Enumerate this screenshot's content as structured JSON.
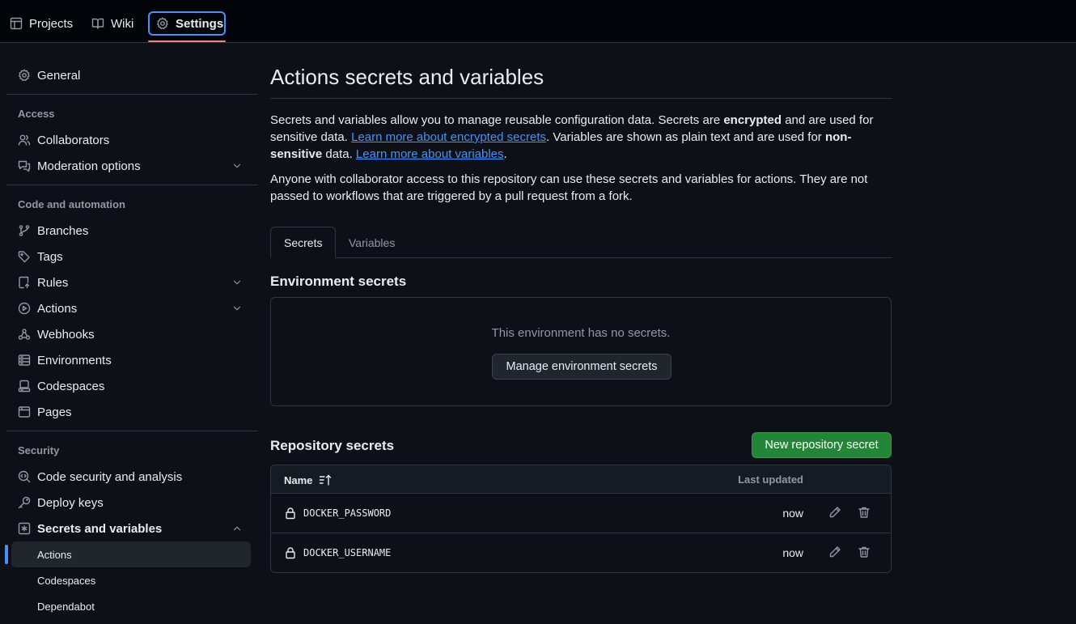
{
  "topnav": {
    "projects": "Projects",
    "wiki": "Wiki",
    "settings": "Settings"
  },
  "sidebar": {
    "general": "General",
    "access_heading": "Access",
    "collaborators": "Collaborators",
    "moderation": "Moderation options",
    "code_heading": "Code and automation",
    "branches": "Branches",
    "tags": "Tags",
    "rules": "Rules",
    "actions": "Actions",
    "webhooks": "Webhooks",
    "environments": "Environments",
    "codespaces": "Codespaces",
    "pages": "Pages",
    "security_heading": "Security",
    "code_security": "Code security and analysis",
    "deploy_keys": "Deploy keys",
    "secrets_vars": "Secrets and variables",
    "sub_actions": "Actions",
    "sub_codespaces": "Codespaces",
    "sub_dependabot": "Dependabot"
  },
  "main": {
    "title": "Actions secrets and variables",
    "intro": {
      "p1a": "Secrets and variables allow you to manage reusable configuration data. Secrets are ",
      "p1b": "encrypted",
      "p1c": " and are used for sensitive data. ",
      "link1": "Learn more about encrypted secrets",
      "p1d": ". Variables are shown as plain text and are used for ",
      "p1e": "non-sensitive",
      "p1f": " data. ",
      "link2": "Learn more about variables",
      "p1g": ".",
      "p2": "Anyone with collaborator access to this repository can use these secrets and variables for actions. They are not passed to workflows that are triggered by a pull request from a fork."
    },
    "tabs": {
      "secrets": "Secrets",
      "variables": "Variables"
    },
    "env": {
      "heading": "Environment secrets",
      "empty_msg": "This environment has no secrets.",
      "manage_button": "Manage environment secrets"
    },
    "repo": {
      "heading": "Repository secrets",
      "new_button": "New repository secret",
      "col_name": "Name",
      "col_updated": "Last updated",
      "rows": [
        {
          "name": "DOCKER_PASSWORD",
          "updated": "now"
        },
        {
          "name": "DOCKER_USERNAME",
          "updated": "now"
        }
      ]
    }
  },
  "colors": {
    "bg": "#0d1117",
    "accent_blue": "#4493f8",
    "active_underline": "#f78166",
    "primary_green": "#238636"
  }
}
